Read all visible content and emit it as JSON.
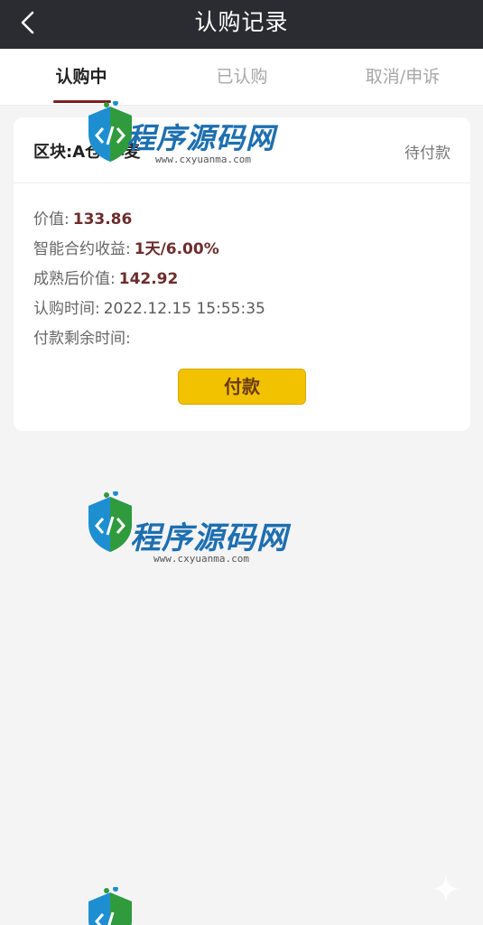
{
  "header": {
    "title": "认购记录",
    "back_icon": "chevron-left-icon"
  },
  "tabs": [
    {
      "label": "认购中",
      "active": true
    },
    {
      "label": "已认购",
      "active": false
    },
    {
      "label": "取消/申诉",
      "active": false
    }
  ],
  "record": {
    "name": "区块:A仓:小麦",
    "status": "待付款",
    "fields": {
      "value_label": "价值:",
      "value": "133.86",
      "yield_label": "智能合约收益:",
      "yield": "1天/6.00%",
      "mature_label": "成熟后价值:",
      "mature_value": "142.92",
      "time_label": "认购时间:",
      "time": "2022.12.15 15:55:35",
      "remaining_label": "付款剩余时间:",
      "remaining": ""
    },
    "pay_button": "付款"
  },
  "watermark": {
    "text": "程序源码网",
    "site": "www.cxyuanma.com"
  },
  "colors": {
    "nav_bg": "#2b2c31",
    "tab_indicator": "#7d1f1f",
    "value_color": "#6d2d2d",
    "pay_button": "#f2c100",
    "page_bg": "#f4f4f5"
  }
}
